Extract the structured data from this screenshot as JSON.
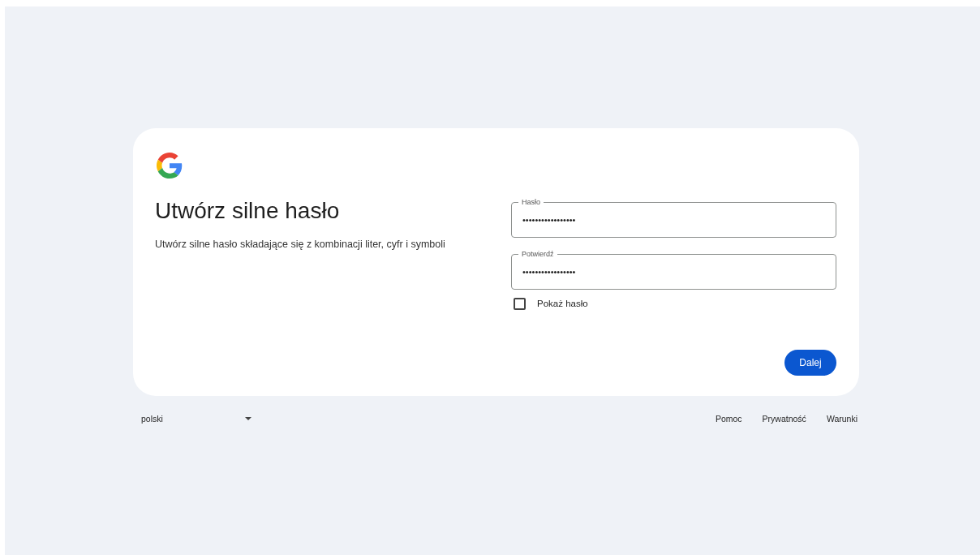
{
  "card": {
    "title": "Utwórz silne hasło",
    "subtitle": "Utwórz silne hasło składające się z kombinacji liter, cyfr i symboli",
    "fields": [
      {
        "label": "Hasło",
        "value": "•••••••••••••••••"
      },
      {
        "label": "Potwierdź",
        "value": "•••••••••••••••••"
      }
    ],
    "show_password": {
      "label": "Pokaż hasło",
      "checked": false
    },
    "next_button": "Dalej"
  },
  "footer": {
    "language": "polski",
    "links": [
      "Pomoc",
      "Prywatność",
      "Warunki"
    ]
  }
}
